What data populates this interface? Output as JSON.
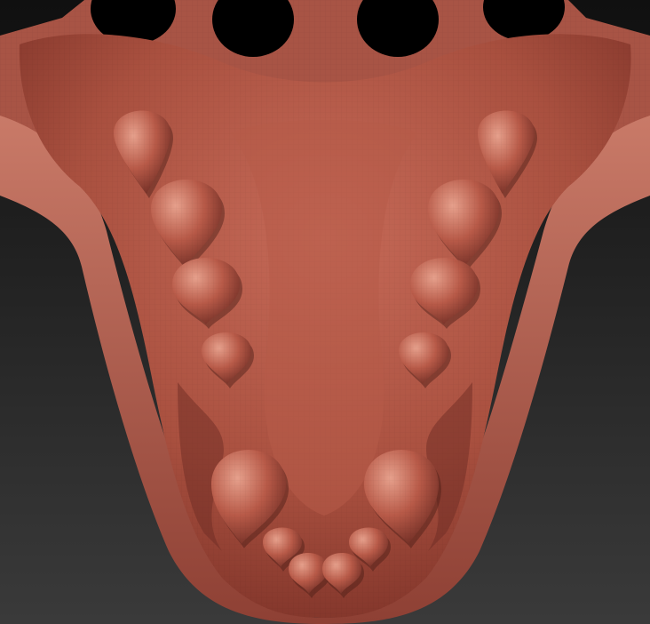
{
  "viewport": {
    "background_top": "#101010",
    "background_bottom": "#3a3a3a"
  },
  "model": {
    "skin_color": "#b0584a",
    "skin_highlight": "#d98a78",
    "skin_shadow": "#5e2620",
    "tooth_color": "#c0604f",
    "upper_teeth_per_side": 4,
    "front_teeth_count": 6,
    "sockets_visible": 4
  }
}
